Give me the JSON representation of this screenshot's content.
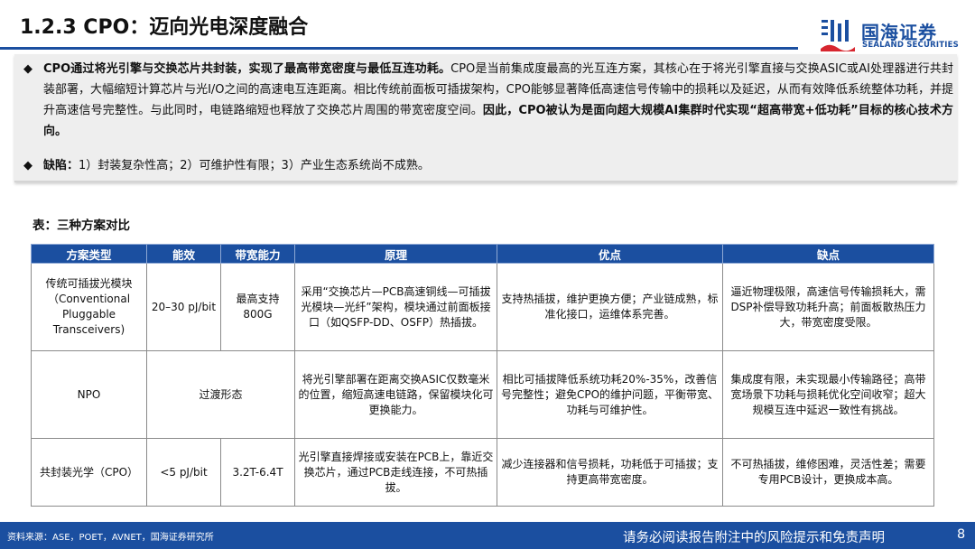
{
  "header": {
    "title": "1.2.3 CPO：迈向光电深度融合",
    "logo_cn": "国海证券",
    "logo_en": "SEALAND SECURITIES"
  },
  "summary": {
    "bullet_symbol": "◆",
    "p1_bold": "CPO通过将光引擎与交换芯片共封装，实现了最高带宽密度与最低互连功耗。",
    "p1_text": "CPO是当前集成度最高的光互连方案，其核心在于将光引擎直接与交换ASIC或AI处理器进行共封装部署，大幅缩短计算芯片与光I/O之间的高速电互连距离。相比传统前面板可插拔架构，CPO能够显著降低高速信号传输中的损耗以及延迟，从而有效降低系统整体功耗，并提升高速信号完整性。与此同时，电链路缩短也释放了交换芯片周围的带宽密度空间。",
    "p1_conclusion": "因此，CPO被认为是面向超大规模AI集群时代实现“超高带宽+低功耗”目标的核心技术方向。",
    "p2_bold": "缺陷：",
    "p2_text": "1）封装复杂性高；2）可维护性有限；3）产业生态系统尚不成熟。"
  },
  "table": {
    "title": "表：三种方案对比",
    "headers": [
      "方案类型",
      "能效",
      "带宽能力",
      "原理",
      "优点",
      "缺点"
    ],
    "rows": [
      {
        "type": "传统可插拔光模块（Conventional Pluggable Transceivers)",
        "efficiency": "20–30 pJ/bit",
        "bandwidth": "最高支持800G",
        "principle": "采用“交换芯片—PCB高速铜线—可插拔光模块—光纤”架构，模块通过前面板接口（如QSFP-DD、OSFP）热插拔。",
        "pros": "支持热插拔，维护更换方便；产业链成熟，标准化接口，运维体系完善。",
        "cons": "逼近物理极限，高速信号传输损耗大，需DSP补偿导致功耗升高；前面板散热压力大，带宽密度受限。"
      },
      {
        "type": "NPO",
        "efficiency_bandwidth": "过渡形态",
        "principle": "将光引擎部署在距离交换ASIC仅数毫米的位置，缩短高速电链路，保留模块化可更换能力。",
        "pros": "相比可插拔降低系统功耗20%-35%，改善信号完整性；避免CPO的维护问题，平衡带宽、功耗与可维护性。",
        "cons": "集成度有限，未实现最小传输路径；高带宽场景下功耗与损耗优化空间收窄；超大规模互连中延迟一致性有挑战。"
      },
      {
        "type": "共封装光学（CPO）",
        "efficiency": "<5 pJ/bit",
        "bandwidth": "3.2T-6.4T",
        "principle": "光引擎直接焊接或安装在PCB上，靠近交换芯片，通过PCB走线连接，不可热插拔。",
        "pros": "减少连接器和信号损耗，功耗低于可插拔；支持更高带宽密度。",
        "cons": "不可热插拔，维修困难，灵活性差；需要专用PCB设计，更换成本高。"
      }
    ]
  },
  "footer": {
    "source": "资料来源：ASE，POET，AVNET，国海证券研究所",
    "disclaimer": "请务必阅读报告附注中的风险提示和免责声明",
    "page": "8"
  },
  "colors": {
    "brand_blue": "#1b4fa0",
    "logo_red": "#d7262f",
    "summary_bg": "#eeeeee"
  }
}
